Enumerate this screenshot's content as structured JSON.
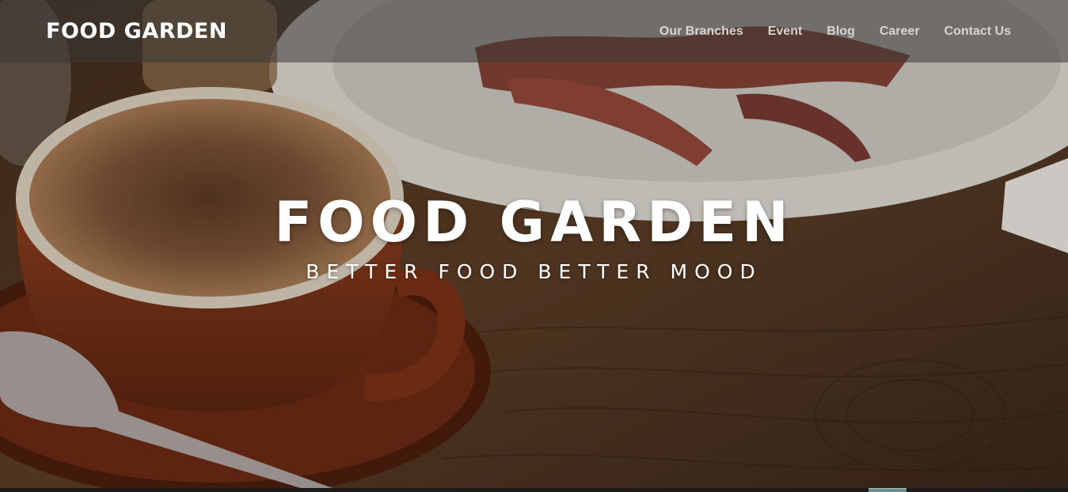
{
  "brand": {
    "name": "FOOD GARDEN"
  },
  "nav": {
    "items": [
      {
        "label": "Our Branches"
      },
      {
        "label": "Event"
      },
      {
        "label": "Blog"
      },
      {
        "label": "Career"
      },
      {
        "label": "Contact Us"
      }
    ]
  },
  "hero": {
    "title": "FOOD GARDEN",
    "subtitle": "BETTER FOOD BETTER MOOD",
    "background_image": "coffee-cup-and-bacon-photo"
  },
  "colors": {
    "navbar": "#3c3a38",
    "text": "#ffffff",
    "nav_text": "#d8d4d0"
  }
}
